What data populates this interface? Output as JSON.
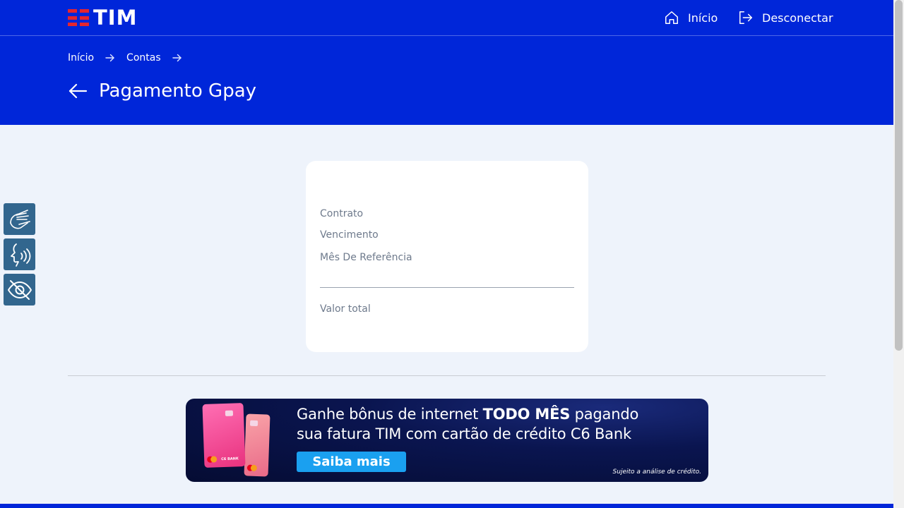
{
  "header": {
    "logo_text": "TIM",
    "nav": {
      "home_label": "Início",
      "logout_label": "Desconectar"
    }
  },
  "breadcrumb": {
    "items": [
      "Início",
      "Contas"
    ]
  },
  "page": {
    "title": "Pagamento Gpay"
  },
  "accessibility": {
    "buttons": [
      "sign-language-icon",
      "voice-reader-icon",
      "high-contrast-icon"
    ]
  },
  "invoice_card": {
    "contract_label": "Contrato",
    "due_label": "Vencimento",
    "reference_month_label": "Mês De Referência",
    "total_label": "Valor total"
  },
  "banner": {
    "line1_prefix": "Ganhe bônus de internet ",
    "line1_bold": "TODO MÊS",
    "line1_suffix": " pagando",
    "line2": "sua fatura TIM com cartão de crédito C6 Bank",
    "button_label": "Saiba mais",
    "note": "Sujeito a análise de crédito.",
    "card_brand": "C6 BANK"
  },
  "colors": {
    "brand_blue": "#0026d9",
    "tim_red": "#e4252f",
    "page_bg": "#eef3fb",
    "access_button": "#32668e",
    "banner_button": "#1aa0f0"
  }
}
